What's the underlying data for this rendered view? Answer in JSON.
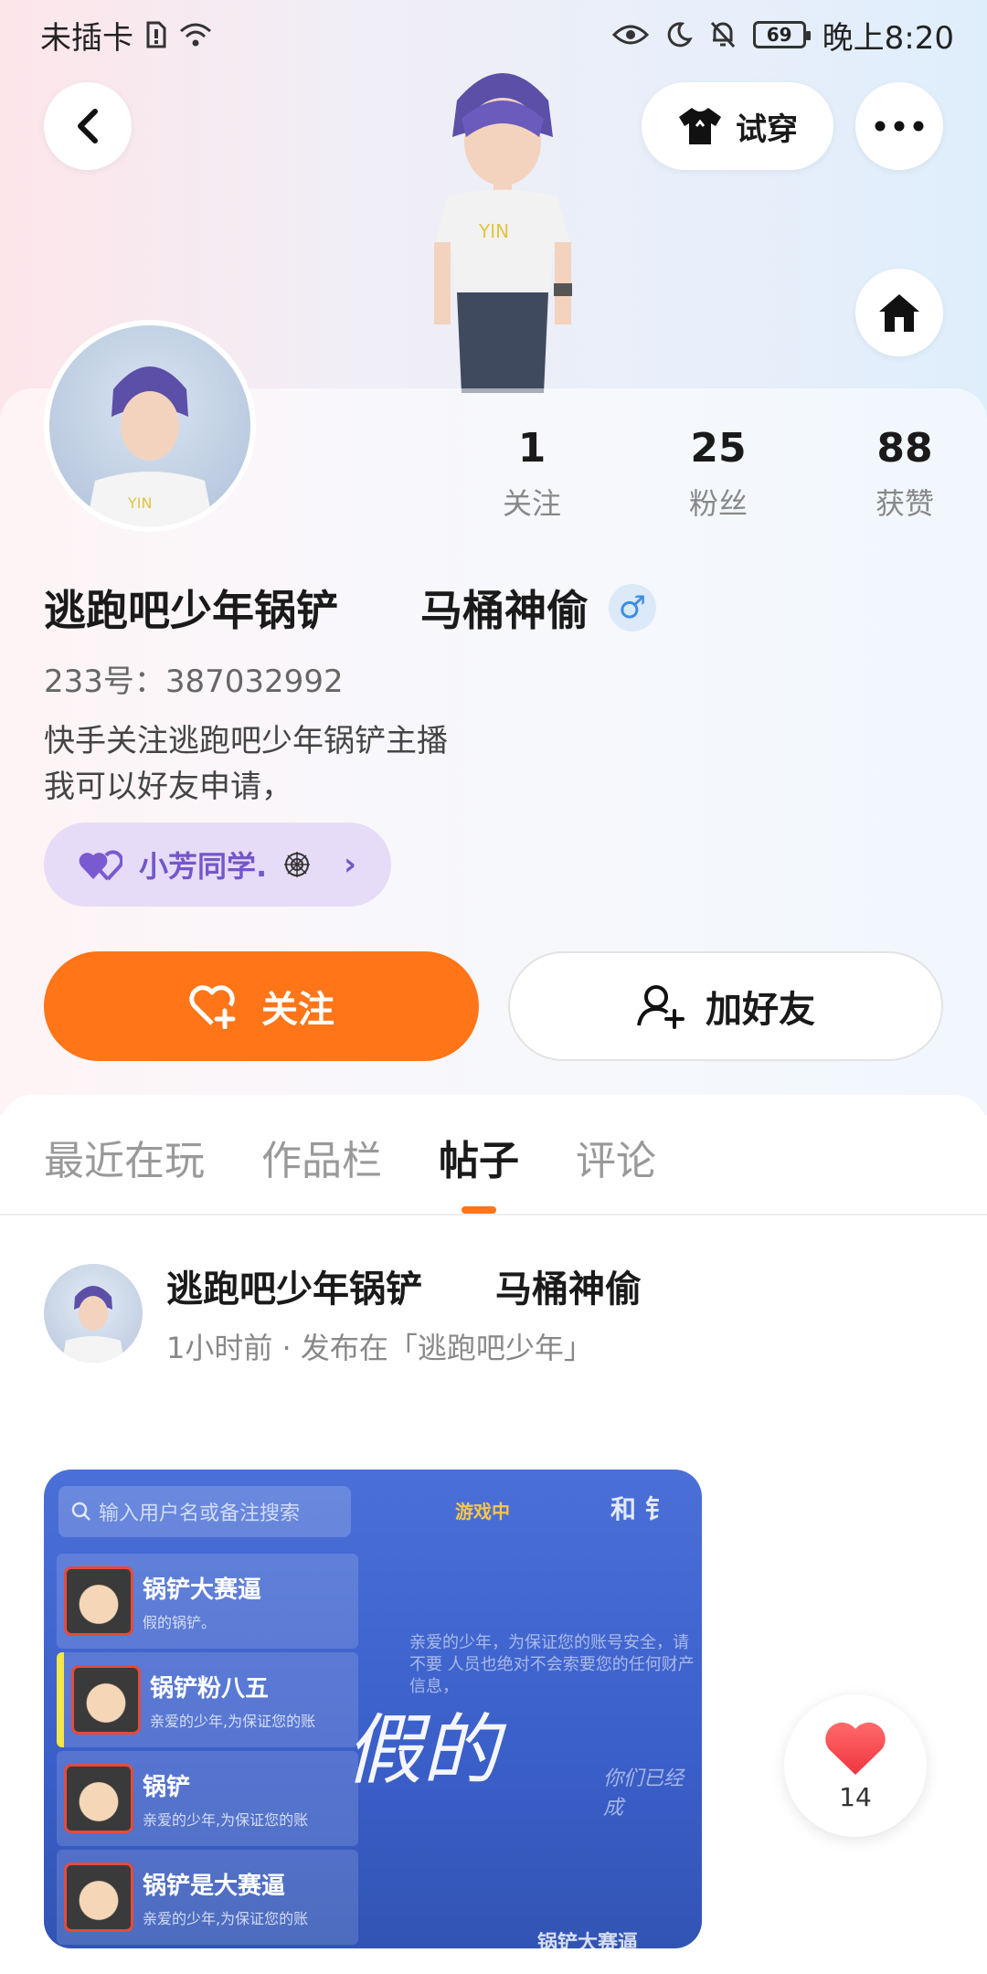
{
  "status_bar": {
    "carrier": "未插卡",
    "battery": "69",
    "time": "晚上8:20"
  },
  "header": {
    "try_on_label": "试穿"
  },
  "stats": [
    {
      "value": "1",
      "label": "关注"
    },
    {
      "value": "25",
      "label": "粉丝"
    },
    {
      "value": "88",
      "label": "获赞"
    }
  ],
  "profile": {
    "name_part1": "逃跑吧少年锅铲",
    "name_part2": "马桶神偷",
    "gender_symbol": "♂",
    "uid": "233号：387032992",
    "bio_line1": "快手关注逃跑吧少年锅铲主播",
    "bio_line2": "我可以好友申请，",
    "close_friend": "小芳同学."
  },
  "actions": {
    "follow_label": "关注",
    "add_friend_label": "加好友"
  },
  "tabs": [
    {
      "label": "最近在玩"
    },
    {
      "label": "作品栏"
    },
    {
      "label": "帖子"
    },
    {
      "label": "评论"
    }
  ],
  "post": {
    "author_part1": "逃跑吧少年锅铲",
    "author_part2": "马桶神偷",
    "time_info": "1小时前 · 发布在「逃跑吧少年」",
    "image": {
      "search_placeholder": "输入用户名或备注搜索",
      "status_tag": "游戏中",
      "top_right": "和  钅",
      "rows": [
        {
          "name": "锅铲大赛逼",
          "sub": "假的锅铲。"
        },
        {
          "name": "锅铲粉八五",
          "sub": "亲爱的少年,为保证您的账"
        },
        {
          "name": "锅铲",
          "sub": "亲爱的少年,为保证您的账"
        },
        {
          "name": "锅铲是大赛逼",
          "sub": "亲爱的少年,为保证您的账"
        }
      ],
      "notice": "亲爱的少年，为保证您的账号安全，请不要 人员也绝对不会索要您的任何财产信息，",
      "overlay_text": "假的",
      "lost_text": "你们已经成",
      "bottom_text": "锅铲大赛逼"
    },
    "likes": "14"
  }
}
